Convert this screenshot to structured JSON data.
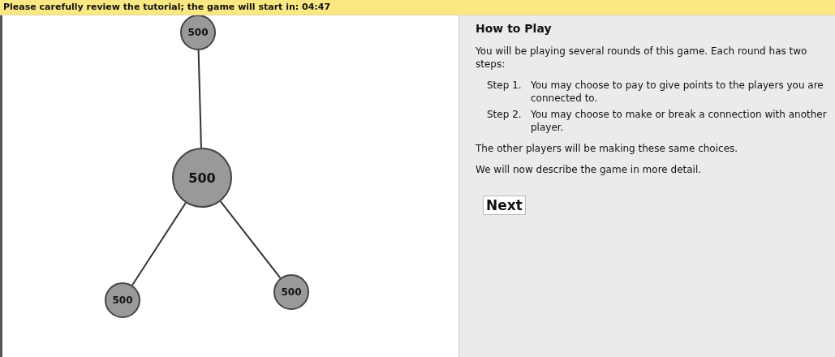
{
  "banner": {
    "text": "Please carefully review the tutorial; the game will start in: 04:47"
  },
  "network": {
    "nodes": [
      {
        "kind": "other",
        "score": "500"
      },
      {
        "kind": "self",
        "score": "500"
      },
      {
        "kind": "other",
        "score": "500"
      },
      {
        "kind": "other",
        "score": "500"
      }
    ]
  },
  "instructions": {
    "title": "How to Play",
    "intro": "You will be playing several rounds of this game. Each round has two steps:",
    "steps": [
      {
        "label": "Step 1.",
        "text": "You may choose to pay to give points to the players you are connected to."
      },
      {
        "label": "Step 2.",
        "text": "You may choose to make or break a connection with another player."
      }
    ],
    "paragraphs": [
      "The other players will be making these same choices.",
      "We will now describe the game in more detail."
    ],
    "button": "Next"
  }
}
